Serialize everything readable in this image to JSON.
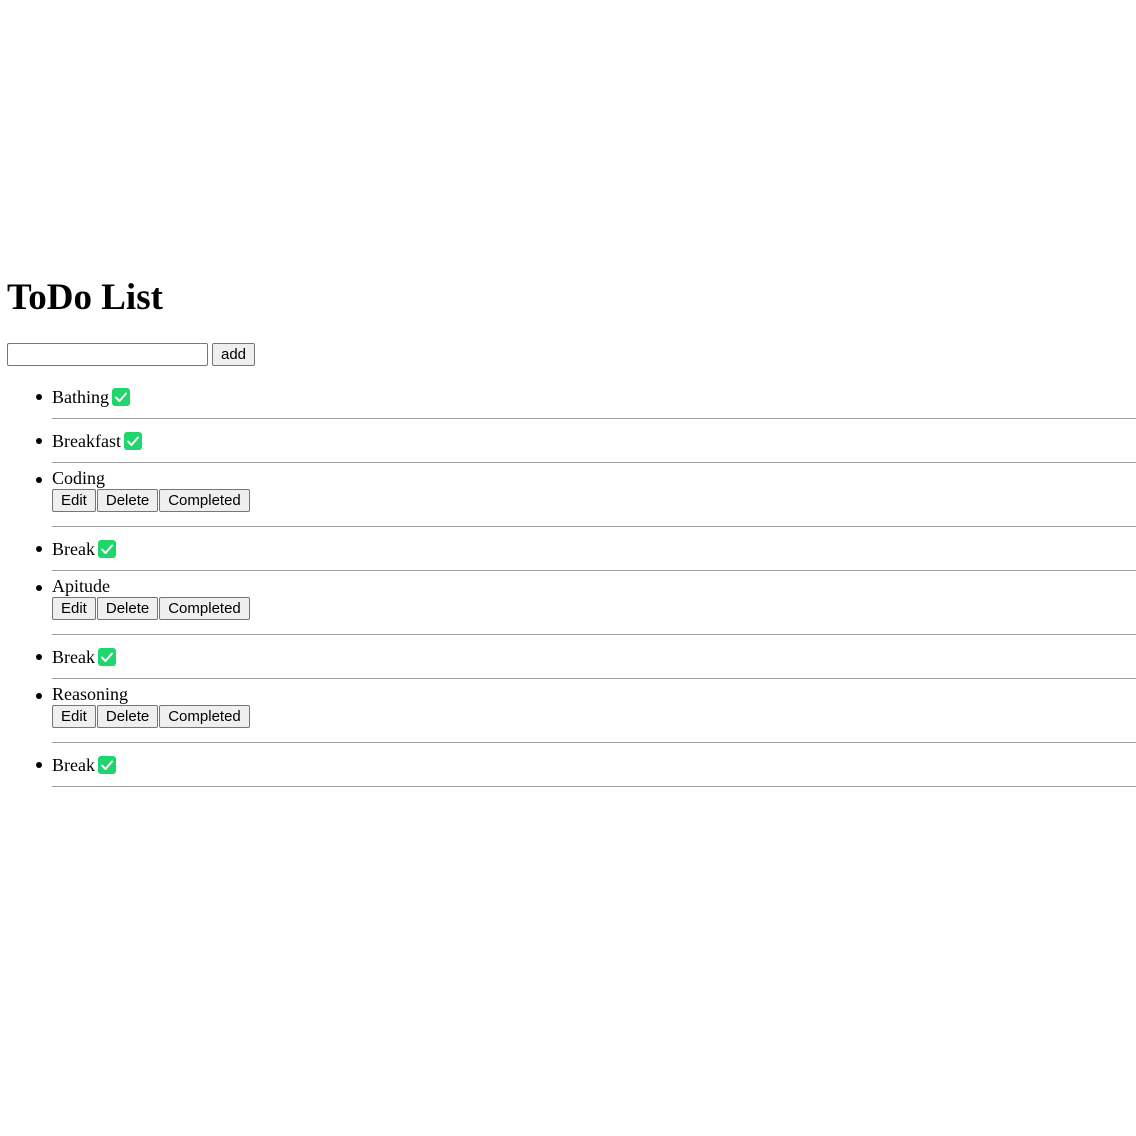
{
  "header": {
    "title": "ToDo List"
  },
  "add_form": {
    "input_value": "",
    "input_placeholder": "",
    "add_label": "add"
  },
  "actions": {
    "edit_label": "Edit",
    "delete_label": "Delete",
    "completed_label": "Completed"
  },
  "colors": {
    "check_green": "#1ed66b",
    "divider": "#9e9e9e"
  },
  "todos": [
    {
      "text": "Bathing",
      "completed": true,
      "icon": "check-icon"
    },
    {
      "text": "Breakfast",
      "completed": true,
      "icon": "check-icon"
    },
    {
      "text": "Coding",
      "completed": false
    },
    {
      "text": "Break",
      "completed": true,
      "icon": "check-icon"
    },
    {
      "text": "Apitude",
      "completed": false
    },
    {
      "text": "Break",
      "completed": true,
      "icon": "check-icon"
    },
    {
      "text": "Reasoning",
      "completed": false
    },
    {
      "text": "Break",
      "completed": true,
      "icon": "check-icon"
    }
  ]
}
